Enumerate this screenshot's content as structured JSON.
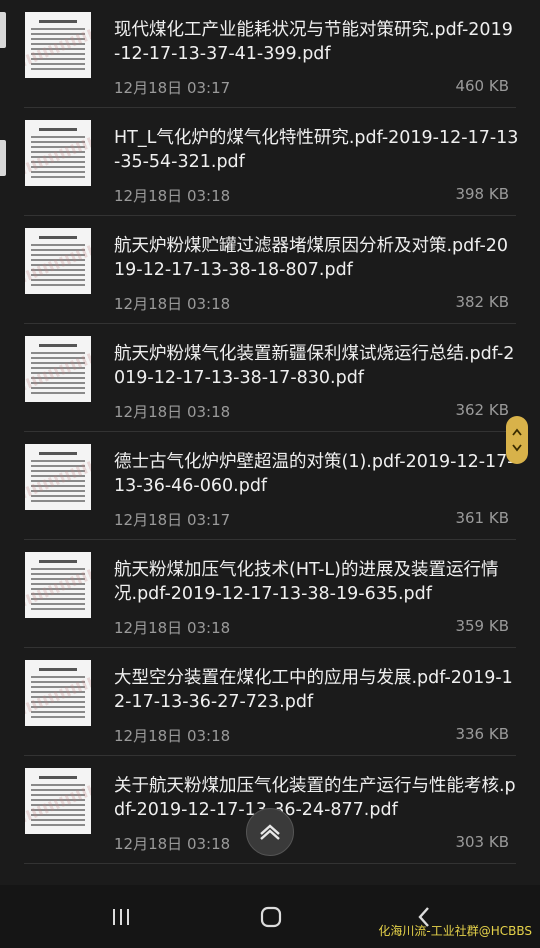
{
  "files": [
    {
      "title": "现代煤化工产业能耗状况与节能对策研究.pdf-2019-12-17-13-37-41-399.pdf",
      "date": "12月18日 03:17",
      "size": "460 KB"
    },
    {
      "title": "HT_L气化炉的煤气化特性研究.pdf-2019-12-17-13-35-54-321.pdf",
      "date": "12月18日 03:18",
      "size": "398 KB"
    },
    {
      "title": "航天炉粉煤贮罐过滤器堵煤原因分析及对策.pdf-2019-12-17-13-38-18-807.pdf",
      "date": "12月18日 03:18",
      "size": "382 KB"
    },
    {
      "title": "航天炉粉煤气化装置新疆保利煤试烧运行总结.pdf-2019-12-17-13-38-17-830.pdf",
      "date": "12月18日 03:18",
      "size": "362 KB"
    },
    {
      "title": "德士古气化炉炉壁超温的对策(1).pdf-2019-12-17-13-36-46-060.pdf",
      "date": "12月18日 03:17",
      "size": "361 KB"
    },
    {
      "title": "航天粉煤加压气化技术(HT-L)的进展及装置运行情况.pdf-2019-12-17-13-38-19-635.pdf",
      "date": "12月18日 03:18",
      "size": "359 KB"
    },
    {
      "title": "大型空分装置在煤化工中的应用与发展.pdf-2019-12-17-13-36-27-723.pdf",
      "date": "12月18日 03:18",
      "size": "336 KB"
    },
    {
      "title": "关于航天粉煤加压气化装置的生产运行与性能考核.pdf-2019-12-17-13-36-24-877.pdf",
      "date": "12月18日 03:18",
      "size": "303 KB"
    }
  ],
  "watermark": "化海川流-工业社群@HCBBS",
  "icons": {
    "recent_apps": "recent-apps-icon",
    "home": "home-icon",
    "back": "back-icon",
    "scroll_top": "chevron-up-icon",
    "fast_scroll": "fast-scroll-icon"
  },
  "colors": {
    "background": "#1b1b1b",
    "text_primary": "#efefef",
    "text_secondary": "#9a9a9a",
    "fast_scroll": "#d8b24a",
    "watermark": "#e5d24a"
  }
}
